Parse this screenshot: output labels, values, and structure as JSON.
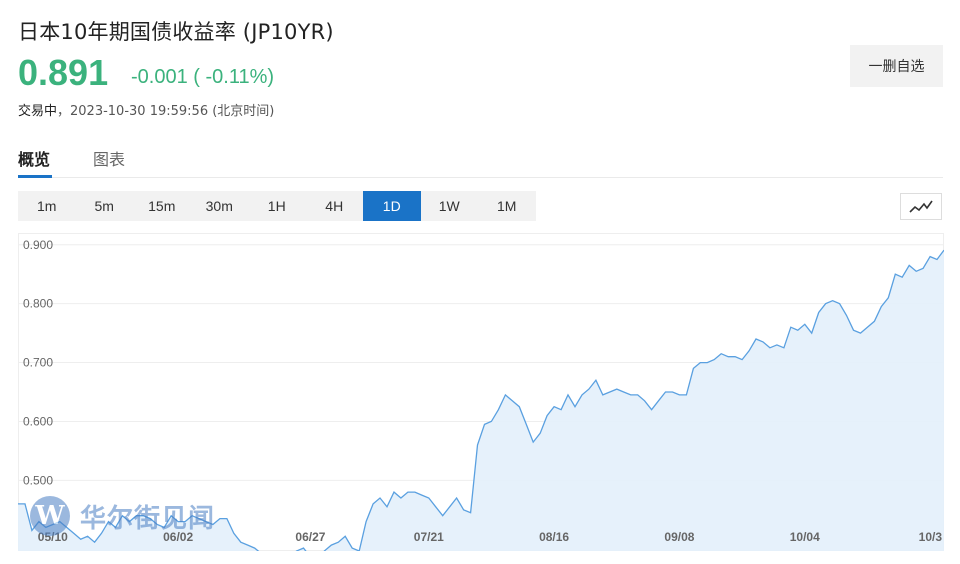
{
  "header": {
    "title": "日本10年期国债收益率 (JP10YR)",
    "price": "0.891",
    "change": "-0.001 ( -0.11%)",
    "status_label": "交易中",
    "timestamp": "，2023-10-30 19:59:56 (北京时间)",
    "remove_button": "一删自选"
  },
  "tabs": [
    {
      "label": "概览",
      "active": true
    },
    {
      "label": "图表",
      "active": false
    }
  ],
  "periods": [
    {
      "label": "1m",
      "active": false
    },
    {
      "label": "5m",
      "active": false
    },
    {
      "label": "15m",
      "active": false
    },
    {
      "label": "30m",
      "active": false
    },
    {
      "label": "1H",
      "active": false
    },
    {
      "label": "4H",
      "active": false
    },
    {
      "label": "1D",
      "active": true
    },
    {
      "label": "1W",
      "active": false
    },
    {
      "label": "1M",
      "active": false
    }
  ],
  "watermark": {
    "logo": "W",
    "text": "华尔街见闻"
  },
  "colors": {
    "accent": "#1a73c7",
    "up_down": "#3bb27d",
    "line": "#5aa0e0",
    "fill": "#e3effb"
  },
  "chart_data": {
    "type": "area",
    "ylim": [
      0.38,
      0.92
    ],
    "yticks": [
      0.5,
      0.6,
      0.7,
      0.8,
      0.9
    ],
    "ytick_labels": [
      "0.500",
      "0.600",
      "0.700",
      "0.800",
      "0.900"
    ],
    "xtick_labels": [
      "05/10",
      "06/02",
      "06/27",
      "07/21",
      "08/16",
      "09/08",
      "10/04",
      "10/3"
    ],
    "xtick_index": [
      5,
      23,
      42,
      59,
      77,
      95,
      113,
      134
    ],
    "grid": true,
    "values": [
      0.46,
      0.46,
      0.415,
      0.43,
      0.42,
      0.425,
      0.43,
      0.42,
      0.41,
      0.4,
      0.405,
      0.395,
      0.41,
      0.43,
      0.42,
      0.44,
      0.43,
      0.44,
      0.44,
      0.435,
      0.425,
      0.42,
      0.44,
      0.43,
      0.43,
      0.44,
      0.435,
      0.43,
      0.425,
      0.435,
      0.435,
      0.41,
      0.395,
      0.39,
      0.385,
      0.375,
      0.375,
      0.37,
      0.36,
      0.37,
      0.38,
      0.385,
      0.37,
      0.36,
      0.38,
      0.39,
      0.395,
      0.405,
      0.385,
      0.38,
      0.43,
      0.46,
      0.47,
      0.455,
      0.48,
      0.47,
      0.48,
      0.48,
      0.475,
      0.47,
      0.455,
      0.44,
      0.455,
      0.47,
      0.45,
      0.445,
      0.56,
      0.595,
      0.6,
      0.62,
      0.645,
      0.635,
      0.625,
      0.595,
      0.565,
      0.58,
      0.61,
      0.625,
      0.62,
      0.645,
      0.625,
      0.645,
      0.655,
      0.67,
      0.645,
      0.65,
      0.655,
      0.65,
      0.645,
      0.645,
      0.635,
      0.62,
      0.635,
      0.65,
      0.65,
      0.645,
      0.645,
      0.69,
      0.7,
      0.7,
      0.705,
      0.715,
      0.71,
      0.71,
      0.705,
      0.72,
      0.74,
      0.735,
      0.725,
      0.73,
      0.725,
      0.76,
      0.755,
      0.765,
      0.75,
      0.785,
      0.8,
      0.805,
      0.8,
      0.78,
      0.755,
      0.75,
      0.76,
      0.77,
      0.795,
      0.81,
      0.85,
      0.845,
      0.865,
      0.855,
      0.86,
      0.88,
      0.875,
      0.891
    ]
  }
}
